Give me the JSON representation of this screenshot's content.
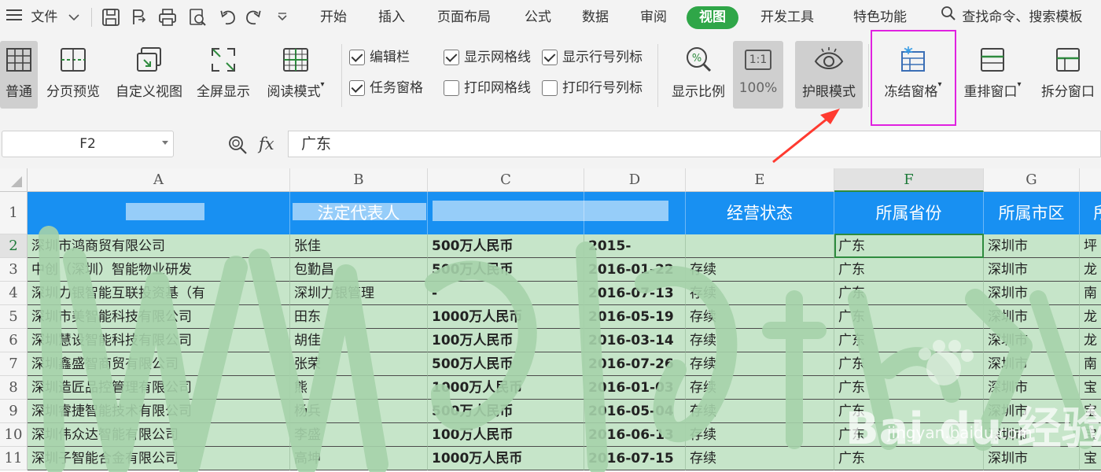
{
  "menubar": {
    "file_label": "文件",
    "tabs": [
      "开始",
      "插入",
      "页面布局",
      "公式",
      "数据",
      "审阅",
      "视图",
      "开发工具",
      "特色功能"
    ],
    "active_tab": "视图",
    "search_label": "查找命令、搜索模板"
  },
  "ribbon": {
    "normal": "普通",
    "page_break": "分页预览",
    "custom_view": "自定义视图",
    "full_screen": "全屏显示",
    "reading_mode": "阅读模式",
    "edit_bar": "编辑栏",
    "task_pane": "任务窗格",
    "show_gridlines": "显示网格线",
    "print_gridlines": "打印网格线",
    "show_headings": "显示行号列标",
    "print_headings": "打印行号列标",
    "zoom": "显示比例",
    "one_to_one": "1:1",
    "zoom_100": "100%",
    "eye_protection": "护眼模式",
    "freeze_panes": "冻结窗格",
    "arrange": "重排窗口",
    "split": "拆分窗口"
  },
  "checks": {
    "edit_bar": true,
    "task_pane": true,
    "show_gridlines": true,
    "print_gridlines": false,
    "show_headings": true,
    "print_headings": false
  },
  "formula_bar": {
    "name_box": "F2",
    "fx_label": "fx",
    "value": "广东"
  },
  "sheet": {
    "columns": [
      "A",
      "B",
      "C",
      "D",
      "E",
      "F",
      "G",
      ""
    ],
    "rows": [
      "1",
      "2",
      "3",
      "4",
      "5",
      "6",
      "7",
      "8",
      "9",
      "10",
      "11"
    ],
    "header_row": [
      "",
      "法定代表人",
      "",
      "",
      "经营状态",
      "所属省份",
      "所属市区",
      "所"
    ],
    "data": [
      [
        "深圳市鸿商贸有限公司",
        "张佳",
        "500万人民币",
        "2015-",
        "",
        "广东",
        "深圳市",
        "坪"
      ],
      [
        "中创（深圳）智能物业研发",
        "包勤昌",
        "500万人民币",
        "2016-01-22",
        "存续",
        "广东",
        "深圳市",
        "龙"
      ],
      [
        "深圳力银智能互联投资基（有",
        "深圳力银管理",
        "-",
        "2016-07-13",
        "存续",
        "广东",
        "深圳市",
        "南"
      ],
      [
        "深圳市美智能科技有限公司",
        "田东",
        "1000万人民币",
        "2016-05-19",
        "存续",
        "广东",
        "深圳市",
        "龙"
      ],
      [
        "深圳慧设智能科技有限公司",
        "胡佳",
        "100万人民币",
        "2016-03-14",
        "存续",
        "广东",
        "深圳市",
        "龙"
      ],
      [
        "深圳鑫盛智商贸有限公司",
        "张荣",
        "500万人民币",
        "2016-07-26",
        "存续",
        "广东",
        "深圳市",
        "南"
      ],
      [
        "深圳造匠品控管理有限公司",
        "熊",
        "1000万人民币",
        "2016-01-03",
        "存续",
        "广东",
        "深圳市",
        "宝"
      ],
      [
        "深圳睿捷智能技术有限公司",
        "杨兵",
        "500万人民币",
        "2016-05-04",
        "存续",
        "广东",
        "深圳市",
        "宝"
      ],
      [
        "深圳伟众达智能有限公司",
        "李盛",
        "100万人民币",
        "2016-06-13",
        "存续",
        "广东",
        "深圳市",
        "宝"
      ],
      [
        "深圳子智能合金有限公司",
        "高坤",
        "1000万人民币",
        "2016-07-15",
        "存续",
        "广东",
        "深圳市",
        "宝"
      ]
    ],
    "selected_cell": "F2"
  },
  "watermark": {
    "brand": "Bai du 经验",
    "url": "jingyan.baidu.com"
  },
  "colors": {
    "active_tab": "#2fa648",
    "header_fill": "#1890f2",
    "eye_green": "#c6e5c9",
    "annotation": "#e021e0",
    "arrow": "#ff3a30"
  }
}
